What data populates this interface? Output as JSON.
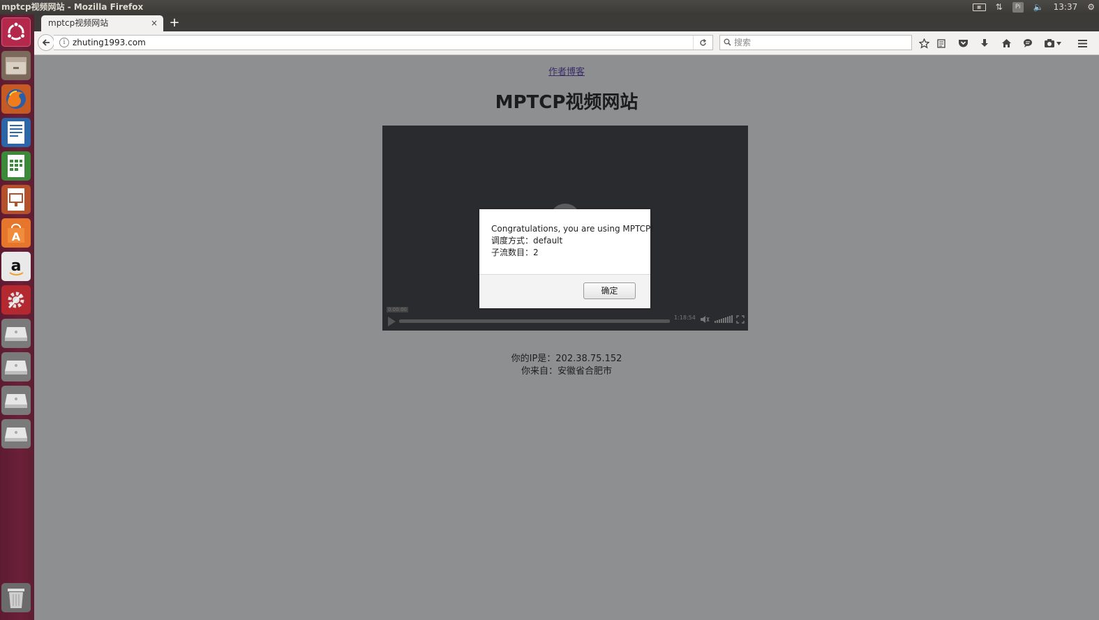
{
  "window": {
    "title": "mptcp视频网站 - Mozilla Firefox"
  },
  "tray": {
    "clock": "13:37",
    "indicator": "Pi"
  },
  "launcher": {
    "items": [
      "ubuntu-logo-icon",
      "file-manager-icon",
      "firefox-icon",
      "writer-icon",
      "calc-icon",
      "impress-icon",
      "software-center-icon",
      "amazon-icon",
      "system-settings-icon",
      "drive-icon",
      "drive-icon",
      "drive-icon",
      "drive-icon",
      "trash-icon"
    ]
  },
  "browser": {
    "tab_label": "mptcp视频网站",
    "tab_close": "×",
    "new_tab": "+",
    "url": "zhuting1993.com",
    "search_placeholder": "搜索"
  },
  "page": {
    "blog_link": "作者博客",
    "title": "MPTCP视频网站",
    "ip_line": "你的IP是：202.38.75.152",
    "location_line": "你来自：安徽省合肥市"
  },
  "video": {
    "tooltip": "0:00:00",
    "duration": "1:18:54"
  },
  "dialog": {
    "line1": "Congratulations, you are using MPTCP!",
    "line2": "调度方式：default",
    "line3": "子流数目：2",
    "ok_label": "确定"
  },
  "colors": {
    "launcher": "#6b2038",
    "overlay": "#8e8f91",
    "topbar": "#3c3b37"
  }
}
